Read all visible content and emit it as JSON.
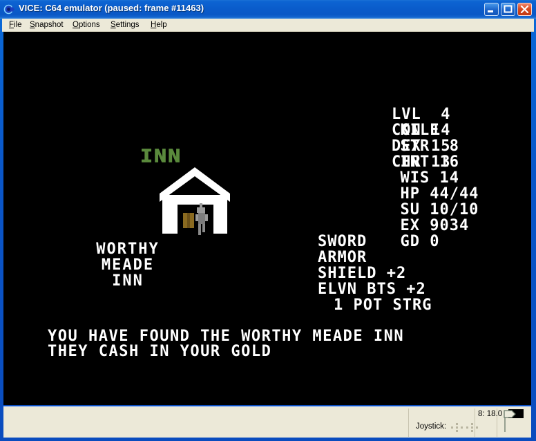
{
  "window": {
    "title": "VICE: C64 emulator (paused: frame #11463)",
    "icon": "vice-app-icon",
    "minimize_label": "Minimize",
    "maximize_label": "Maximize",
    "close_label": "Close"
  },
  "menu": {
    "items": [
      {
        "label": "File",
        "accel": "F",
        "rest": "ile"
      },
      {
        "label": "Snapshot",
        "accel": "S",
        "rest": "napshot"
      },
      {
        "label": "Options",
        "accel": "O",
        "rest": "ptions"
      },
      {
        "label": "Settings",
        "accel": "S",
        "rest": "ettings"
      },
      {
        "label": "Help",
        "accel": "H",
        "rest": "elp"
      }
    ]
  },
  "game": {
    "sign": "INN",
    "inn_name_lines": [
      "WORTHY",
      "MEADE",
      "INN"
    ],
    "messages": [
      "YOU HAVE FOUND THE WORTHY MEADE INN",
      "THEY CASH IN YOUR GOLD"
    ],
    "character": {
      "name": "KILE",
      "level_label": "LVL",
      "level": "4",
      "stats": [
        {
          "left_label": "STR",
          "left_value": "8",
          "right_label": "CON",
          "right_value": "14"
        },
        {
          "left_label": "INT",
          "left_value": "16",
          "right_label": "DEX",
          "right_value": "15"
        },
        {
          "left_label": "WIS",
          "left_value": "14",
          "right_label": "CHR",
          "right_value": "13"
        }
      ],
      "hp_label": "HP",
      "hp": "44/44",
      "su_label": "SU",
      "su": "10/10",
      "ex_label": "EX",
      "ex": "9034",
      "gd_label": "GD",
      "gd": "0",
      "inventory": [
        "SWORD",
        "ARMOR",
        "SHIELD +2",
        "ELVN BTS +2"
      ],
      "potion": "1 POT STRG"
    }
  },
  "statusbar": {
    "joystick_label": "Joystick:",
    "speed": "8: 18.0",
    "drive_icon": "tape-drive-icon",
    "led_state": "off"
  },
  "colors": {
    "screen_background": "#000000",
    "screen_text": "#ffffff",
    "sign_green": "#5a8a3c",
    "title_blue": "#0a5ccb",
    "chrome": "#ece9d8",
    "close_red": "#c13a13",
    "house_white": "#ffffff",
    "barrel_brown": "#8a6a20",
    "figure_grey": "#8a8a8a"
  }
}
